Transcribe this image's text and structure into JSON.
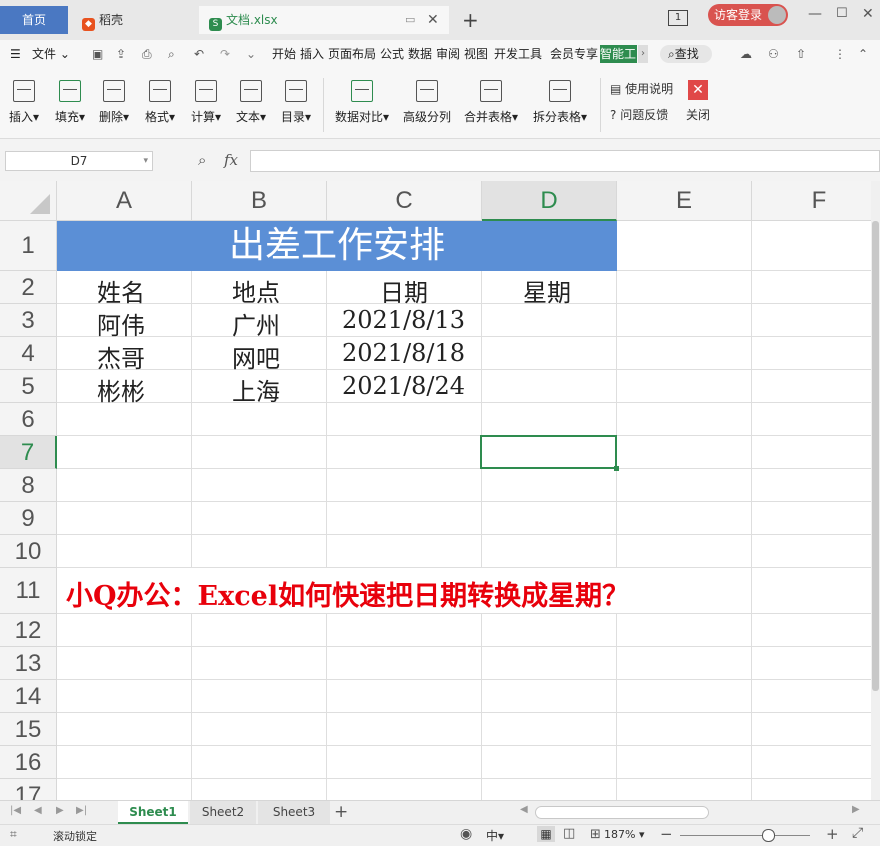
{
  "tabs": {
    "home": "首页",
    "daoke": "稻壳",
    "doc": "文档.xlsx"
  },
  "window": {
    "page_badge": "1",
    "login": "访客登录"
  },
  "menu": {
    "file": "文件",
    "items": [
      "开始",
      "插入",
      "页面布局",
      "公式",
      "数据",
      "审阅",
      "视图",
      "开发工具",
      "会员专享"
    ],
    "active": "智能工",
    "search": "查找"
  },
  "ribbon": {
    "buttons": [
      "插入",
      "填充",
      "删除",
      "格式",
      "计算",
      "文本",
      "目录",
      "数据对比",
      "高级分列",
      "合并表格",
      "拆分表格"
    ],
    "help": "使用说明",
    "feedback": "问题反馈",
    "close": "关闭"
  },
  "formula_bar": {
    "name_box": "D7",
    "fx": "fx",
    "value": ""
  },
  "columns": [
    "A",
    "B",
    "C",
    "D",
    "E",
    "F"
  ],
  "rows": [
    "1",
    "2",
    "3",
    "4",
    "5",
    "6",
    "7",
    "8",
    "9",
    "10",
    "11",
    "12",
    "13",
    "14",
    "15",
    "16",
    "17"
  ],
  "sheet": {
    "title": "出差工作安排",
    "headers": {
      "name": "姓名",
      "place": "地点",
      "date": "日期",
      "weekday": "星期"
    },
    "records": [
      {
        "name": "阿伟",
        "place": "广州",
        "date": "2021/8/13"
      },
      {
        "name": "杰哥",
        "place": "网吧",
        "date": "2021/8/18"
      },
      {
        "name": "彬彬",
        "place": "上海",
        "date": "2021/8/24"
      }
    ],
    "note": "小Q办公：Excel如何快速把日期转换成星期？"
  },
  "sheet_tabs": [
    "Sheet1",
    "Sheet2",
    "Sheet3"
  ],
  "status": {
    "scroll_lock": "滚动锁定",
    "lang": "中",
    "zoom": "187%"
  },
  "colors": {
    "title_fill": "#5b8fd6",
    "accent_green": "#2e8c4f",
    "note_red": "#e8000b",
    "tab_blue": "#4a78c2"
  }
}
